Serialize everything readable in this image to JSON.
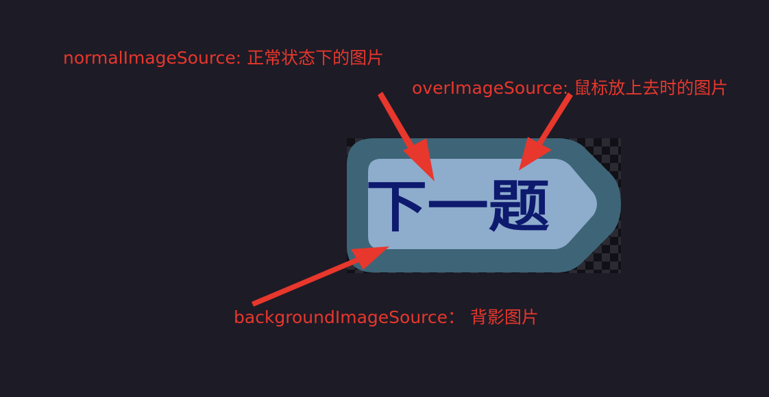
{
  "annotations": {
    "normal": "normalImageSource: 正常状态下的图片",
    "over": "overImageSource: 鼠标放上去时的图片",
    "background": "backgroundImageSource： 背影图片"
  },
  "button": {
    "text": "下一题"
  },
  "colors": {
    "annotation": "#e8372c",
    "background": "#1d1b26",
    "button_outer": "#3d6577",
    "button_inner": "#8eaccc",
    "button_text": "#0d1a6e"
  }
}
